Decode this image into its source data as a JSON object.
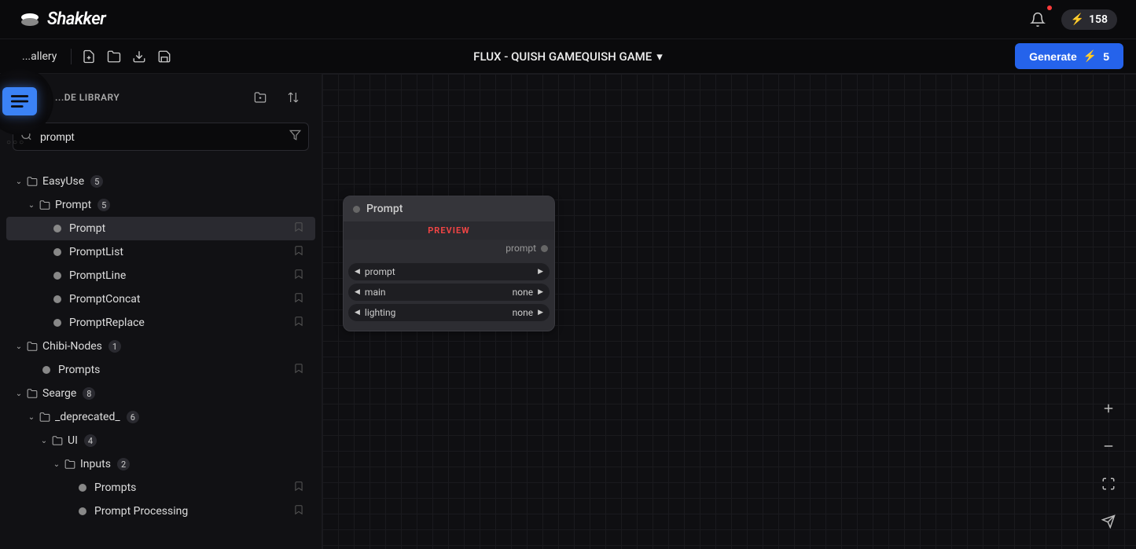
{
  "header": {
    "brand": "Shakker",
    "credits": "158"
  },
  "subheader": {
    "gallery_label": "...allery",
    "project_title": "FLUX - QUISH GAMEQUISH GAME",
    "generate_label": "Generate",
    "generate_cost": "5"
  },
  "library": {
    "title": "...DE LIBRARY",
    "search_value": "prompt",
    "tree": {
      "easyuse": {
        "label": "EasyUse",
        "count": "5"
      },
      "prompt_folder": {
        "label": "Prompt",
        "count": "5"
      },
      "items": {
        "prompt": "Prompt",
        "promptlist": "PromptList",
        "promptline": "PromptLine",
        "promptconcat": "PromptConcat",
        "promptreplace": "PromptReplace"
      },
      "chibi": {
        "label": "Chibi-Nodes",
        "count": "1"
      },
      "chibi_items": {
        "prompts": "Prompts"
      },
      "searge": {
        "label": "Searge",
        "count": "8"
      },
      "deprecated": {
        "label": "_deprecated_",
        "count": "6"
      },
      "ui": {
        "label": "UI",
        "count": "4"
      },
      "inputs": {
        "label": "Inputs",
        "count": "2"
      },
      "inputs_items": {
        "prompts": "Prompts",
        "processing": "Prompt Processing"
      }
    }
  },
  "node": {
    "title": "Prompt",
    "preview": "PREVIEW",
    "output_label": "prompt",
    "params": [
      {
        "name": "prompt",
        "value": ""
      },
      {
        "name": "main",
        "value": "none"
      },
      {
        "name": "lighting",
        "value": "none"
      }
    ]
  }
}
